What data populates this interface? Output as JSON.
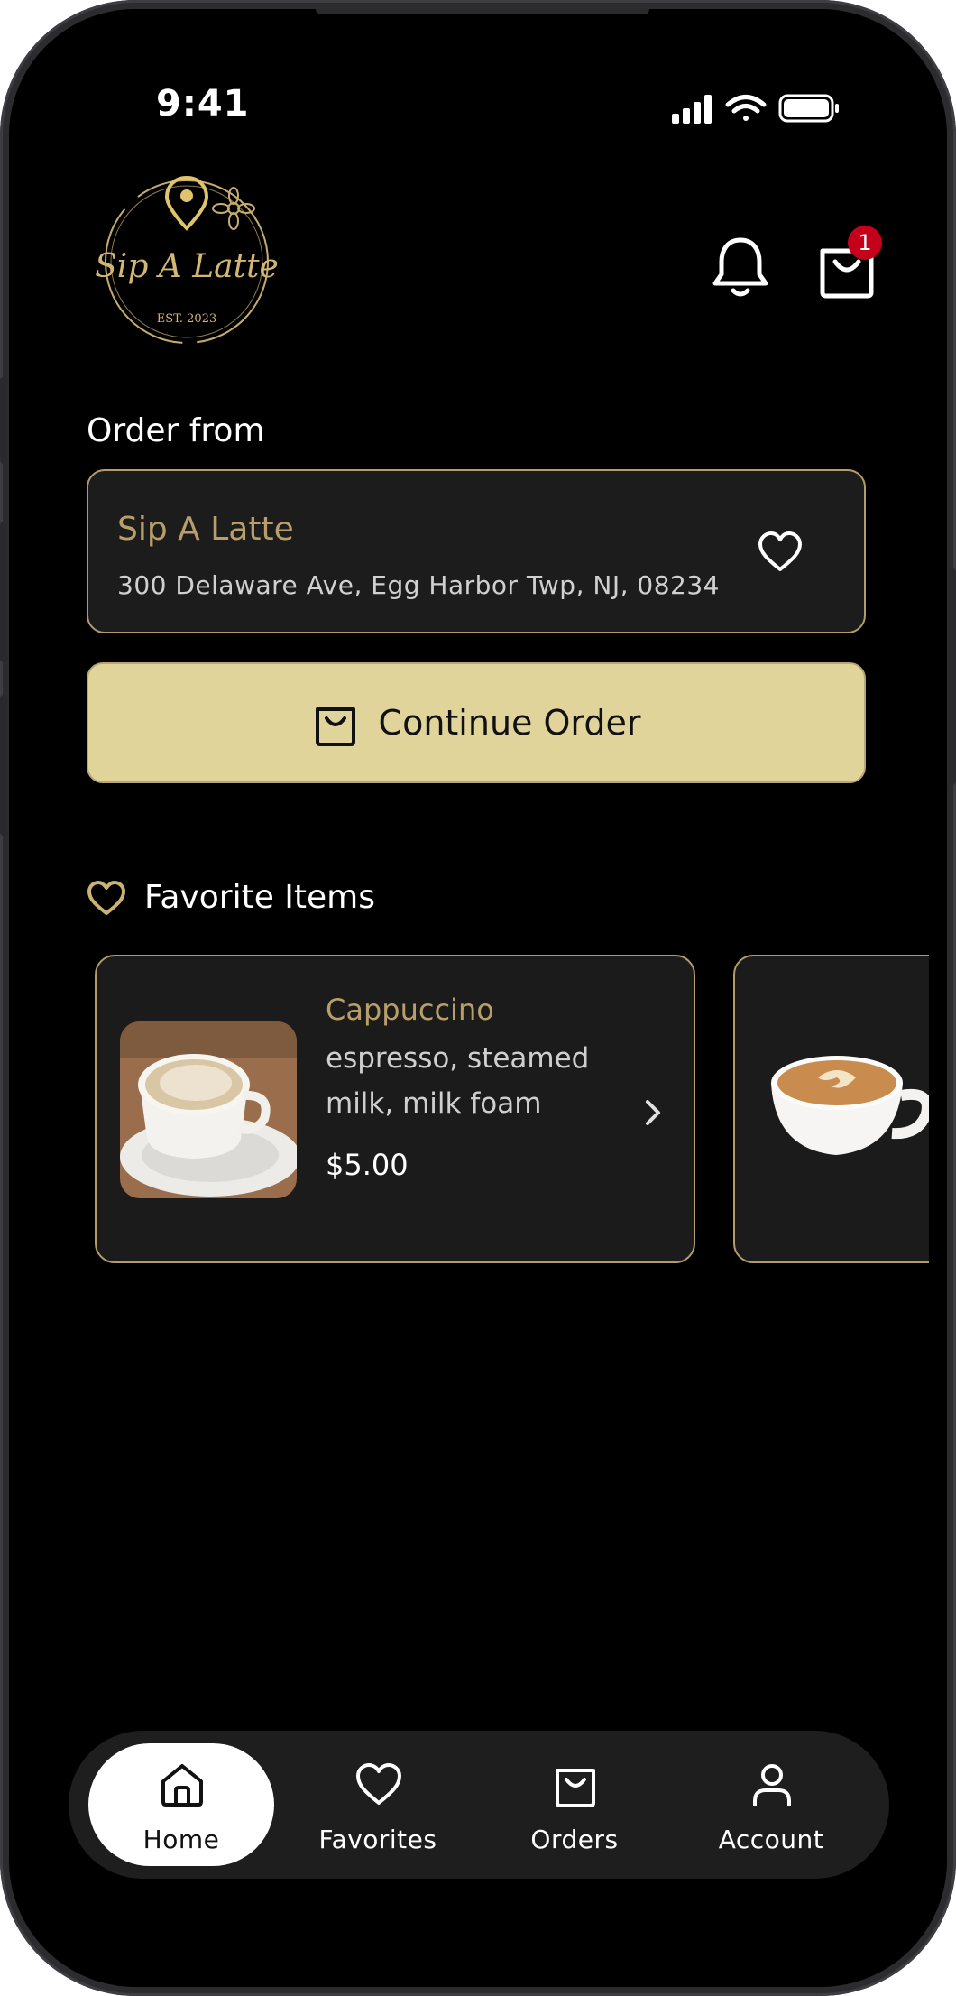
{
  "status_bar": {
    "time": "9:41"
  },
  "header": {
    "logo": {
      "text": "Sip A Latte",
      "sub": "EST. 2023"
    },
    "cart_badge": "1"
  },
  "order_from": {
    "title": "Order from",
    "store_name": "Sip A Latte",
    "address": "300 Delaware Ave, Egg Harbor Twp, NJ, 08234"
  },
  "continue_button": {
    "label": "Continue Order"
  },
  "favorites": {
    "title": "Favorite Items",
    "items": [
      {
        "name": "Cappuccino",
        "desc_line1": "espresso, steamed",
        "desc_line2": "milk, milk foam",
        "price": "$5.00"
      }
    ]
  },
  "bottom_nav": {
    "items": [
      {
        "label": "Home",
        "icon": "home-icon",
        "active": true
      },
      {
        "label": "Favorites",
        "icon": "heart-icon",
        "active": false
      },
      {
        "label": "Orders",
        "icon": "bag-icon",
        "active": false
      },
      {
        "label": "Account",
        "icon": "person-icon",
        "active": false
      }
    ]
  },
  "colors": {
    "accent_gold": "#b89f6a",
    "button_fill": "#e1d49b",
    "badge_red": "#c4001b",
    "background": "#000000",
    "card": "#1c1c1c"
  }
}
